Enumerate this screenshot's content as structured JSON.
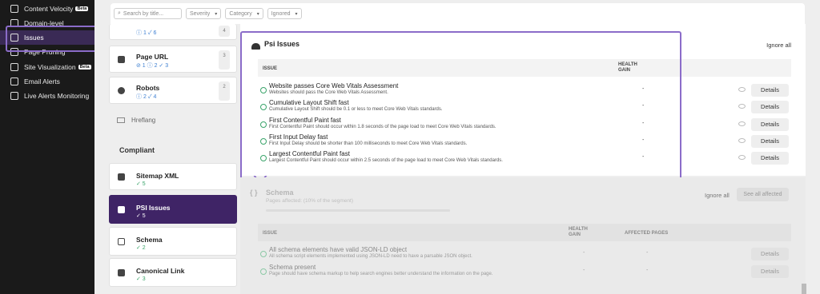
{
  "sidebar": {
    "items": [
      {
        "label": "Content Velocity",
        "badge": "Beta"
      },
      {
        "label": "Domain-level",
        "badge": ""
      },
      {
        "label": "Issues",
        "badge": ""
      },
      {
        "label": "Page Pruning",
        "badge": ""
      },
      {
        "label": "Site Visualization",
        "badge": "Beta"
      },
      {
        "label": "Email Alerts",
        "badge": ""
      },
      {
        "label": "Live Alerts Monitoring",
        "badge": ""
      }
    ]
  },
  "filters": {
    "search_placeholder": "Search by title...",
    "severity": "Severity",
    "category": "Category",
    "ignored": "Ignored"
  },
  "left": {
    "top_card": {
      "stat_a": "1",
      "stat_b": "6",
      "badge": "4"
    },
    "cards": [
      {
        "title": "Page URL",
        "stats": "⊘ 1  ⓘ 2  ✓ 3",
        "badge": "3"
      },
      {
        "title": "Robots",
        "stats": "ⓘ 2  ✓ 4",
        "badge": "2"
      }
    ],
    "hreflang": "Hreflang",
    "compliant_label": "Compliant",
    "compliant_cards": [
      {
        "title": "Sitemap XML",
        "stats": "✓ 5"
      },
      {
        "title": "PSI Issues",
        "stats": "✓ 5"
      },
      {
        "title": "Schema",
        "stats": "✓ 2"
      },
      {
        "title": "Canonical Link",
        "stats": "✓ 3"
      }
    ]
  },
  "psi": {
    "title": "Psi Issues",
    "ignore_all": "Ignore all",
    "col_issue": "ISSUE",
    "col_health_1": "HEALTH",
    "col_health_2": "GAIN",
    "rows": [
      {
        "title": "Website passes Core Web Vitals Assessment",
        "desc": "Websites should pass the Core Web Vitals Assessment.",
        "gain": "-",
        "action": "Details"
      },
      {
        "title": "Cumulative Layout Shift fast",
        "desc": "Cumulative Layout Shift should be 0.1 or less to meet Core Web Vitals standards.",
        "gain": "-",
        "action": "Details"
      },
      {
        "title": "First Contentful Paint fast",
        "desc": "First Contentful Paint should occur within 1.8 seconds of the page load to meet Core Web Vitals standards.",
        "gain": "-",
        "action": "Details"
      },
      {
        "title": "First Input Delay fast",
        "desc": "First Input Delay should be shorter than 100 milliseconds to meet Core Web Vitals standards.",
        "gain": "-",
        "action": "Details"
      },
      {
        "title": "Largest Contentful Paint fast",
        "desc": "Largest Contentful Paint should occur within 2.5 seconds of the page load to meet Core Web Vitals standards.",
        "gain": "-",
        "action": "Details"
      }
    ]
  },
  "schema": {
    "title": "Schema",
    "subtitle": "Pages affected: (10% of the segment)",
    "ignore_all": "Ignore all",
    "see_all": "See all affected",
    "col_issue": "ISSUE",
    "col_health_1": "HEALTH",
    "col_health_2": "GAIN",
    "col_affected": "AFFECTED PAGES",
    "rows": [
      {
        "title": "All schema elements have valid JSON-LD object",
        "desc": "All schema script elements implemented using JSON-LD need to have a parsable JSON object.",
        "gain": "-",
        "affected": "-",
        "action": "Details"
      },
      {
        "title": "Schema present",
        "desc": "Page should have schema markup to help search engines better understand the information on the page.",
        "gain": "-",
        "affected": "-",
        "action": "Details"
      }
    ]
  }
}
